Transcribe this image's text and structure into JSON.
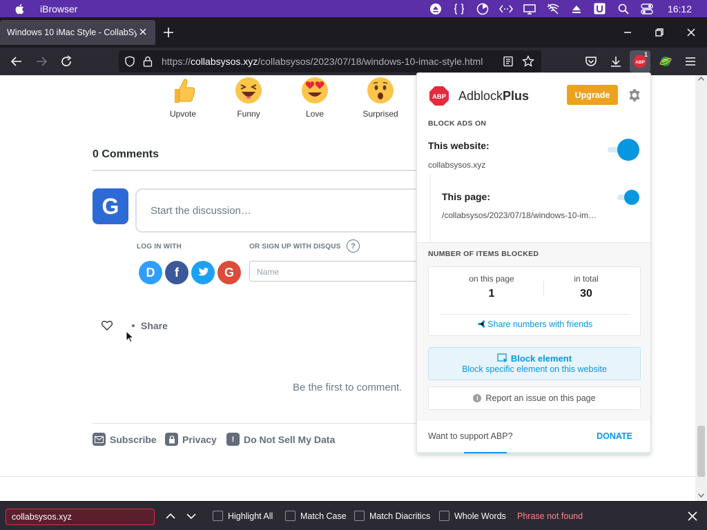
{
  "menubar": {
    "app_name": "iBrowser",
    "clock": "16:12"
  },
  "tab": {
    "title": "Windows 10 iMac Style - CollabSysos"
  },
  "url": {
    "prefix": "https://",
    "host": "collabsysos.xyz",
    "path": "/collabsysos/2023/07/18/windows-10-imac-style.html"
  },
  "toolbar": {
    "abp_badge": "1"
  },
  "reactions": [
    {
      "label": "Upvote",
      "icon": "thumbs-up-emoji"
    },
    {
      "label": "Funny",
      "icon": "laughing-emoji"
    },
    {
      "label": "Love",
      "icon": "heart-eyes-emoji"
    },
    {
      "label": "Surprised",
      "icon": "surprised-emoji"
    }
  ],
  "comments": {
    "title": "0 Comments",
    "avatar_letter": "G",
    "placeholder": "Start the discussion…",
    "login_with": "LOG IN WITH",
    "signup_with": "OR SIGN UP WITH DISQUS",
    "help": "?",
    "name_placeholder": "Name",
    "social": [
      {
        "name": "disqus",
        "letter": "D",
        "color": "#2e9fff"
      },
      {
        "name": "facebook",
        "letter": "f",
        "color": "#3b5998"
      },
      {
        "name": "twitter",
        "letter": "t",
        "color": "#1da1f2"
      },
      {
        "name": "google",
        "letter": "G",
        "color": "#dd4b39"
      }
    ],
    "share": "Share",
    "first": "Be the first to comment."
  },
  "footer": {
    "subscribe": "Subscribe",
    "privacy": "Privacy",
    "do_not_sell": "Do Not Sell My Data"
  },
  "abp": {
    "brand_light": "Adblock",
    "brand_bold": "Plus",
    "logo_text": "ABP",
    "upgrade": "Upgrade",
    "block_ads_on": "BLOCK ADS ON",
    "this_website": "This website:",
    "website_host": "collabsysos.xyz",
    "this_page": "This page:",
    "page_path": "/collabsysos/2023/07/18/windows-10-im…",
    "items_blocked": "NUMBER OF ITEMS BLOCKED",
    "on_this_page_label": "on this page",
    "on_this_page_value": "1",
    "in_total_label": "in total",
    "in_total_value": "30",
    "share_numbers": "Share numbers with friends",
    "block_element": "Block element",
    "block_element_sub": "Block specific element on this website",
    "report": "Report an issue on this page",
    "support": "Want to support ABP?",
    "donate": "DONATE",
    "colors": {
      "accent": "#0797e1",
      "upgrade": "#eda21f",
      "logo": "#e22b3c"
    }
  },
  "findbar": {
    "query": "collabsysos.xyz",
    "highlight_all": "Highlight All",
    "match_case": "Match Case",
    "match_diacritics": "Match Diacritics",
    "whole_words": "Whole Words",
    "status": "Phrase not found"
  }
}
